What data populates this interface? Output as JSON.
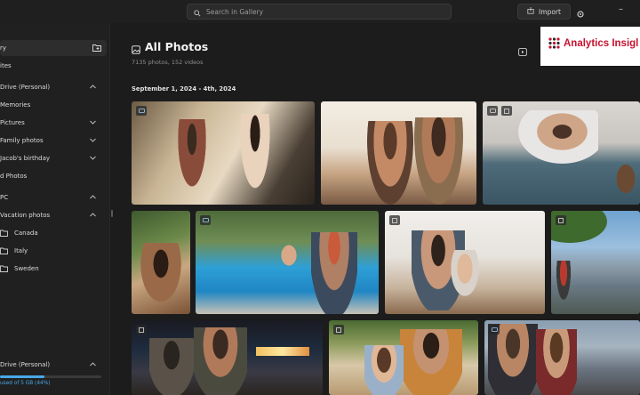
{
  "search": {
    "placeholder": "Search in Gallery"
  },
  "toolbar": {
    "import_label": "Import"
  },
  "sidebar": {
    "items": [
      {
        "label": "ry"
      },
      {
        "label": "ites"
      },
      {
        "label": "Drive (Personal)"
      },
      {
        "label": "Memories"
      },
      {
        "label": "Pictures"
      },
      {
        "label": "Family photos"
      },
      {
        "label": "Jacob's birthday"
      },
      {
        "label": "d Photos"
      },
      {
        "label": "PC"
      },
      {
        "label": "Vacation photos"
      },
      {
        "label": "Canada"
      },
      {
        "label": "Italy"
      },
      {
        "label": "Sweden"
      }
    ],
    "storage": {
      "label": "Drive (Personal)",
      "text": "used of 5 GB (44%)",
      "fraction": 0.44
    }
  },
  "main": {
    "title": "All Photos",
    "counts": "7135 photos, 152 videos",
    "date_group": "September 1, 2024 - 4th, 2024"
  },
  "overlay": {
    "brand": "Analytics Insigl"
  },
  "colors": {
    "accent": "#4aa8e8",
    "brand_red": "#c8102e",
    "background": "#1c1c1c"
  },
  "icons": [
    "search-icon",
    "import-icon",
    "gear-icon",
    "minimize-icon",
    "add-folder-icon",
    "chevron-down-icon",
    "folder-icon",
    "photos-icon",
    "slideshow-icon",
    "video-badge-icon",
    "image-badge-icon"
  ]
}
